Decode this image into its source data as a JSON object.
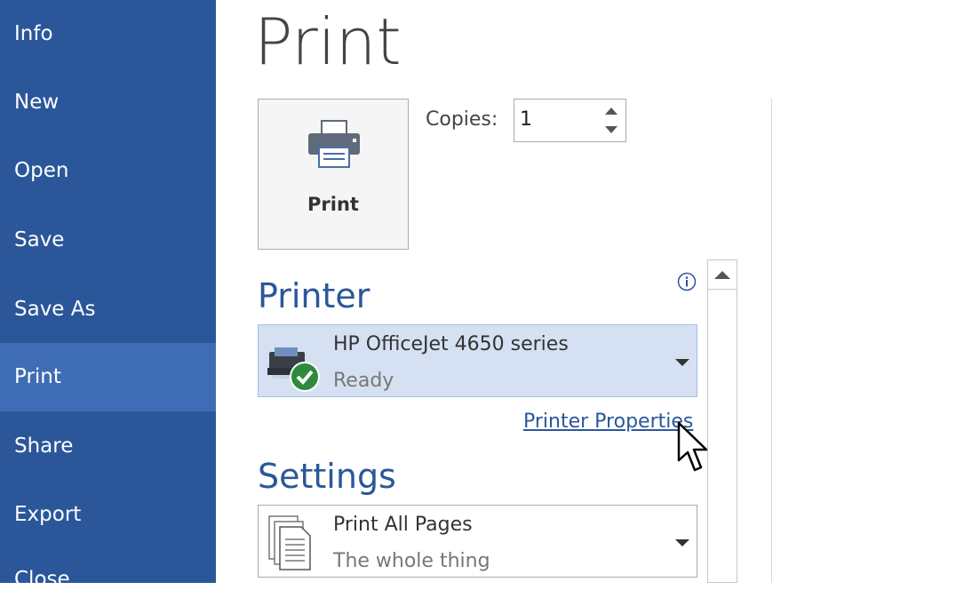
{
  "sidebar": {
    "items": [
      {
        "label": "Info"
      },
      {
        "label": "New"
      },
      {
        "label": "Open"
      },
      {
        "label": "Save"
      },
      {
        "label": "Save As"
      },
      {
        "label": "Print",
        "active": true
      },
      {
        "label": "Share"
      },
      {
        "label": "Export"
      },
      {
        "label": "Close"
      }
    ],
    "background": "#2b579a",
    "active_background": "#3e6db5"
  },
  "main": {
    "title": "Print",
    "print_button_label": "Print",
    "copies": {
      "label": "Copies:",
      "value": "1"
    },
    "printer": {
      "heading": "Printer",
      "name": "HP OfficeJet 4650 series",
      "status": "Ready",
      "icon": "printer-ready-icon",
      "properties_link": "Printer Properties"
    },
    "settings": {
      "heading": "Settings",
      "pages_option": "Print All Pages",
      "pages_description": "The whole thing",
      "icon": "pages-icon"
    }
  },
  "colors": {
    "accent": "#2b579a",
    "selected_bg": "#d5e1f2"
  }
}
